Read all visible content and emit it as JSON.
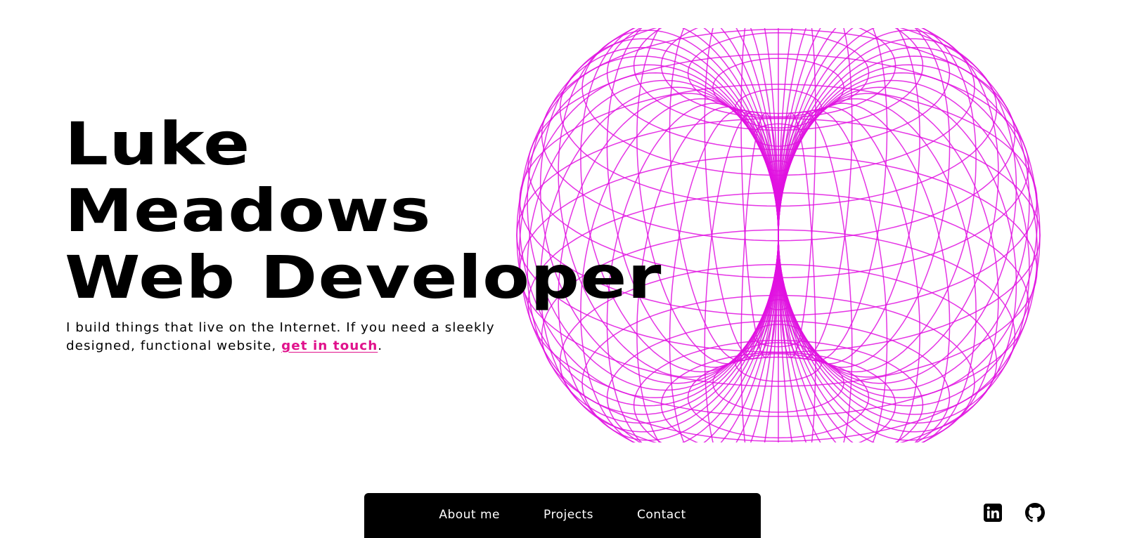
{
  "hero": {
    "line1": "Luke",
    "line2": "Meadows",
    "line3": "Web Developer"
  },
  "tagline": {
    "text_before": "I build things that live on the Internet. If you need a sleekly designed, functional website, ",
    "link_text": "get in touch",
    "text_after": "."
  },
  "nav": {
    "items": [
      {
        "label": "About me"
      },
      {
        "label": "Projects"
      },
      {
        "label": "Contact"
      }
    ]
  },
  "social": {
    "icons": [
      "linkedin-icon",
      "github-icon"
    ]
  },
  "colors": {
    "accent": "#e0128c",
    "wireframe": "#e010e0",
    "wireframe_inner": "#c8f5c8",
    "text": "#000000",
    "nav_bg": "#000000",
    "nav_text": "#ffffff"
  }
}
